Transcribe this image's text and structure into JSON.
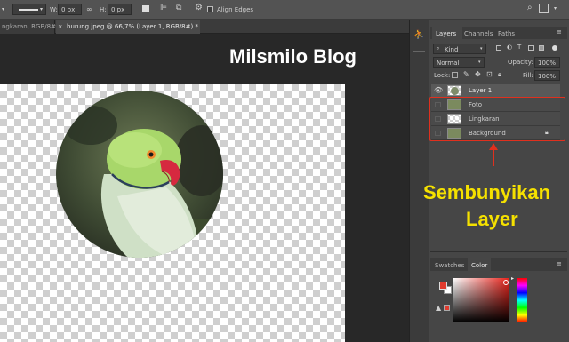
{
  "options_bar": {
    "w_label": "W:",
    "w_value": "0 px",
    "link_icon": "link-icon",
    "h_label": "H:",
    "h_value": "0 px",
    "align_edges_label": "Align Edges"
  },
  "tabs": [
    {
      "label": "ngkaran, RGB/8#)"
    },
    {
      "label": "burung.jpeg @ 66,7% (Layer 1, RGB/8#) *"
    }
  ],
  "watermark": "Milsmilo Blog",
  "annotation": {
    "line1": "Sembunyikan",
    "line2": "Layer",
    "color": "#f5e100"
  },
  "layers_panel": {
    "tabs": [
      "Layers",
      "Channels",
      "Paths"
    ],
    "kind_label": "Kind",
    "blend_mode": "Normal",
    "opacity_label": "Opacity:",
    "opacity_value": "100%",
    "lock_label": "Lock:",
    "fill_label": "Fill:",
    "fill_value": "100%",
    "layers": [
      {
        "name": "Layer 1",
        "visible": true
      },
      {
        "name": "Foto",
        "visible": false
      },
      {
        "name": "Lingkaran",
        "visible": false
      },
      {
        "name": "Background",
        "visible": false,
        "locked": true
      }
    ]
  },
  "color_panel": {
    "tabs": [
      "Swatches",
      "Color"
    ],
    "foreground_color": "#e03b2e",
    "background_color": "#ffffff"
  },
  "highlight_color": "#e0301e"
}
